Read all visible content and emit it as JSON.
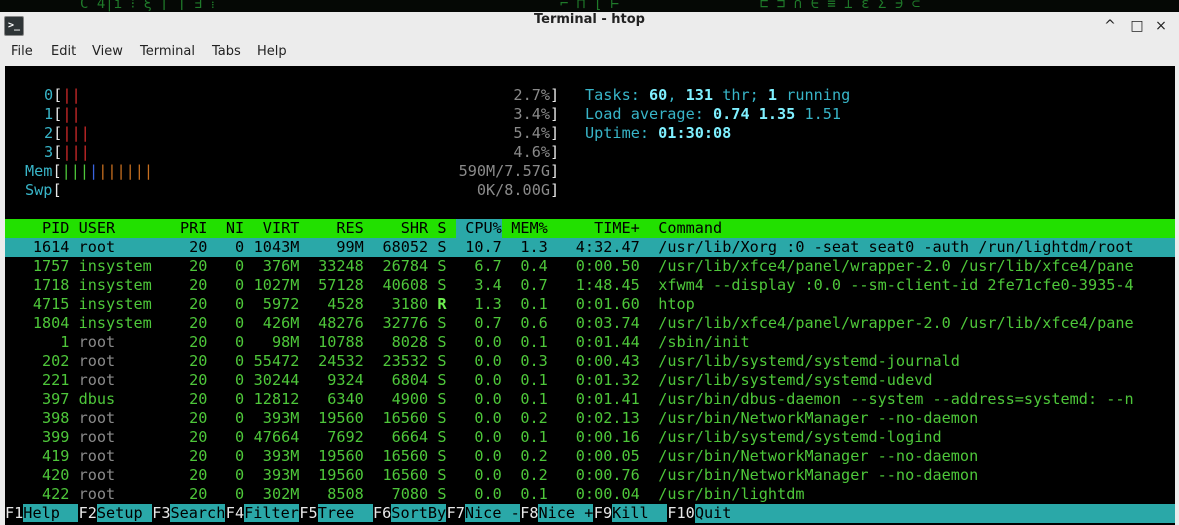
{
  "window": {
    "title": "Terminal - htop",
    "icon": "terminal-icon",
    "controls": [
      "^",
      "□",
      "×"
    ]
  },
  "menu": [
    "File",
    "Edit",
    "View",
    "Terminal",
    "Tabs",
    "Help"
  ],
  "meters": {
    "cpus": [
      {
        "label": "0",
        "bars": "||",
        "value": "2.7%"
      },
      {
        "label": "1",
        "bars": "||",
        "value": "3.4%"
      },
      {
        "label": "2",
        "bars": "|||",
        "value": "5.4%"
      },
      {
        "label": "3",
        "bars": "|||",
        "value": "4.6%"
      }
    ],
    "mem": {
      "label": "Mem",
      "bars_green": "|||",
      "bars_blue": "|",
      "bars_orange": "||||||",
      "value": "590M/7.57G"
    },
    "swp": {
      "label": "Swp",
      "value": "0K/8.00G"
    }
  },
  "stats": {
    "tasks_label": "Tasks: ",
    "tasks": "60",
    "sep1": ", ",
    "threads": "131",
    "thr_label": " thr; ",
    "running": "1",
    "running_label": " running",
    "load_label": "Load average: ",
    "load1": "0.74",
    "load5": "1.35",
    "load15": "1.51",
    "uptime_label": "Uptime: ",
    "uptime": "01:30:08"
  },
  "columns": {
    "pid": "PID",
    "user": "USER",
    "pri": "PRI",
    "ni": "NI",
    "virt": "VIRT",
    "res": "RES",
    "shr": "SHR",
    "s": "S",
    "cpu": "CPU%",
    "mem": "MEM%",
    "time": "TIME+",
    "command": "Command"
  },
  "processes": [
    {
      "pid": "1614",
      "user": "root",
      "pri": "20",
      "ni": "0",
      "virt": "1043M",
      "res": "99M",
      "shr": "68052",
      "s": "S",
      "cpu": "10.7",
      "mem": "1.3",
      "time": "4:32.47",
      "command": "/usr/lib/Xorg :0 -seat seat0 -auth /run/lightdm/root"
    },
    {
      "pid": "1757",
      "user": "insystem",
      "pri": "20",
      "ni": "0",
      "virt": "376M",
      "res": "33248",
      "shr": "26784",
      "s": "S",
      "cpu": "6.7",
      "mem": "0.4",
      "time": "0:00.50",
      "command": "/usr/lib/xfce4/panel/wrapper-2.0 /usr/lib/xfce4/pane"
    },
    {
      "pid": "1718",
      "user": "insystem",
      "pri": "20",
      "ni": "0",
      "virt": "1027M",
      "res": "57128",
      "shr": "40608",
      "s": "S",
      "cpu": "3.4",
      "mem": "0.7",
      "time": "1:48.45",
      "command": "xfwm4 --display :0.0 --sm-client-id 2fe71cfe0-3935-4"
    },
    {
      "pid": "4715",
      "user": "insystem",
      "pri": "20",
      "ni": "0",
      "virt": "5972",
      "res": "4528",
      "shr": "3180",
      "s": "R",
      "cpu": "1.3",
      "mem": "0.1",
      "time": "0:01.60",
      "command": "htop"
    },
    {
      "pid": "1804",
      "user": "insystem",
      "pri": "20",
      "ni": "0",
      "virt": "426M",
      "res": "48276",
      "shr": "32776",
      "s": "S",
      "cpu": "0.7",
      "mem": "0.6",
      "time": "0:03.74",
      "command": "/usr/lib/xfce4/panel/wrapper-2.0 /usr/lib/xfce4/pane"
    },
    {
      "pid": "1",
      "user": "root",
      "pri": "20",
      "ni": "0",
      "virt": "98M",
      "res": "10788",
      "shr": "8028",
      "s": "S",
      "cpu": "0.0",
      "mem": "0.1",
      "time": "0:01.44",
      "command": "/sbin/init"
    },
    {
      "pid": "202",
      "user": "root",
      "pri": "20",
      "ni": "0",
      "virt": "55472",
      "res": "24532",
      "shr": "23532",
      "s": "S",
      "cpu": "0.0",
      "mem": "0.3",
      "time": "0:00.43",
      "command": "/usr/lib/systemd/systemd-journald"
    },
    {
      "pid": "221",
      "user": "root",
      "pri": "20",
      "ni": "0",
      "virt": "30244",
      "res": "9324",
      "shr": "6804",
      "s": "S",
      "cpu": "0.0",
      "mem": "0.1",
      "time": "0:01.32",
      "command": "/usr/lib/systemd/systemd-udevd"
    },
    {
      "pid": "397",
      "user": "dbus",
      "pri": "20",
      "ni": "0",
      "virt": "12812",
      "res": "6340",
      "shr": "4900",
      "s": "S",
      "cpu": "0.0",
      "mem": "0.1",
      "time": "0:01.41",
      "command": "/usr/bin/dbus-daemon --system --address=systemd: --n"
    },
    {
      "pid": "398",
      "user": "root",
      "pri": "20",
      "ni": "0",
      "virt": "393M",
      "res": "19560",
      "shr": "16560",
      "s": "S",
      "cpu": "0.0",
      "mem": "0.2",
      "time": "0:02.13",
      "command": "/usr/bin/NetworkManager --no-daemon"
    },
    {
      "pid": "399",
      "user": "root",
      "pri": "20",
      "ni": "0",
      "virt": "47664",
      "res": "7692",
      "shr": "6664",
      "s": "S",
      "cpu": "0.0",
      "mem": "0.1",
      "time": "0:00.16",
      "command": "/usr/lib/systemd/systemd-logind"
    },
    {
      "pid": "419",
      "user": "root",
      "pri": "20",
      "ni": "0",
      "virt": "393M",
      "res": "19560",
      "shr": "16560",
      "s": "S",
      "cpu": "0.0",
      "mem": "0.2",
      "time": "0:00.05",
      "command": "/usr/bin/NetworkManager --no-daemon"
    },
    {
      "pid": "420",
      "user": "root",
      "pri": "20",
      "ni": "0",
      "virt": "393M",
      "res": "19560",
      "shr": "16560",
      "s": "S",
      "cpu": "0.0",
      "mem": "0.2",
      "time": "0:00.76",
      "command": "/usr/bin/NetworkManager --no-daemon"
    },
    {
      "pid": "422",
      "user": "root",
      "pri": "20",
      "ni": "0",
      "virt": "302M",
      "res": "8508",
      "shr": "7080",
      "s": "S",
      "cpu": "0.0",
      "mem": "0.1",
      "time": "0:00.04",
      "command": "/usr/bin/lightdm"
    }
  ],
  "fkeys": [
    {
      "key": "F1",
      "label": "Help  "
    },
    {
      "key": "F2",
      "label": "Setup "
    },
    {
      "key": "F3",
      "label": "Search"
    },
    {
      "key": "F4",
      "label": "Filter"
    },
    {
      "key": "F5",
      "label": "Tree  "
    },
    {
      "key": "F6",
      "label": "SortBy"
    },
    {
      "key": "F7",
      "label": "Nice -"
    },
    {
      "key": "F8",
      "label": "Nice +"
    },
    {
      "key": "F9",
      "label": "Kill  "
    },
    {
      "key": "F10",
      "label": "Quit"
    }
  ],
  "colors": {
    "header_bg": "#22e000",
    "selected_bg": "#2aa8a8",
    "terminal_bg": "#000000",
    "stats_value": "#7ff0ff"
  }
}
